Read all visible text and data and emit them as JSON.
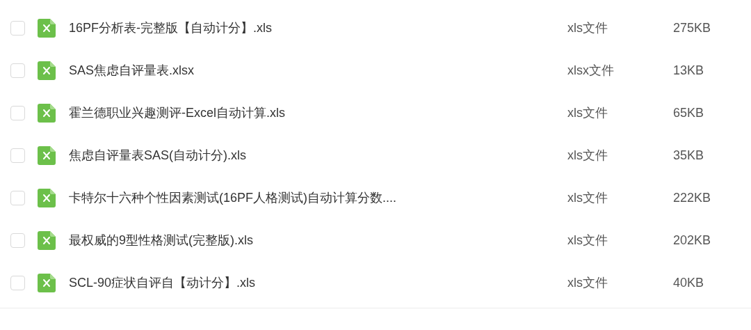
{
  "files": [
    {
      "name": "16PF分析表-完整版【自动计分】.xls",
      "type": "xls文件",
      "size": "275KB",
      "checked": false
    },
    {
      "name": "SAS焦虑自评量表.xlsx",
      "type": "xlsx文件",
      "size": "13KB",
      "checked": false
    },
    {
      "name": "霍兰德职业兴趣测评-Excel自动计算.xls",
      "type": "xls文件",
      "size": "65KB",
      "checked": false
    },
    {
      "name": "焦虑自评量表SAS(自动计分).xls",
      "type": "xls文件",
      "size": "35KB",
      "checked": false
    },
    {
      "name": "卡特尔十六种个性因素测试(16PF人格测试)自动计算分数....",
      "type": "xls文件",
      "size": "222KB",
      "checked": false
    },
    {
      "name": "最权威的9型性格测试(完整版).xls",
      "type": "xls文件",
      "size": "202KB",
      "checked": false
    },
    {
      "name": "SCL-90症状自评自【动计分】.xls",
      "type": "xls文件",
      "size": "40KB",
      "checked": false
    }
  ]
}
